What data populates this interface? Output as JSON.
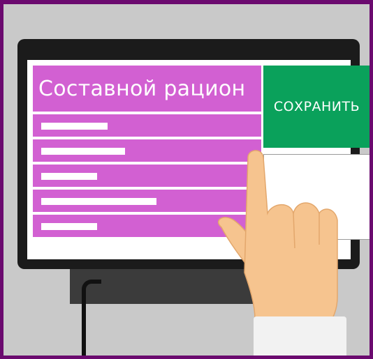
{
  "screen": {
    "title": "Составной рацион",
    "save_button_label": "СОХРАНИТЬ",
    "list_items_count": 5
  },
  "colors": {
    "border": "#6b0a6f",
    "background": "#c9c9c9",
    "monitor": "#1b1b1b",
    "menu_panel": "#d260d2",
    "save_button": "#0aa15b",
    "list_bar": "#ffffff"
  },
  "icons": [
    "pointing-hand-icon"
  ]
}
